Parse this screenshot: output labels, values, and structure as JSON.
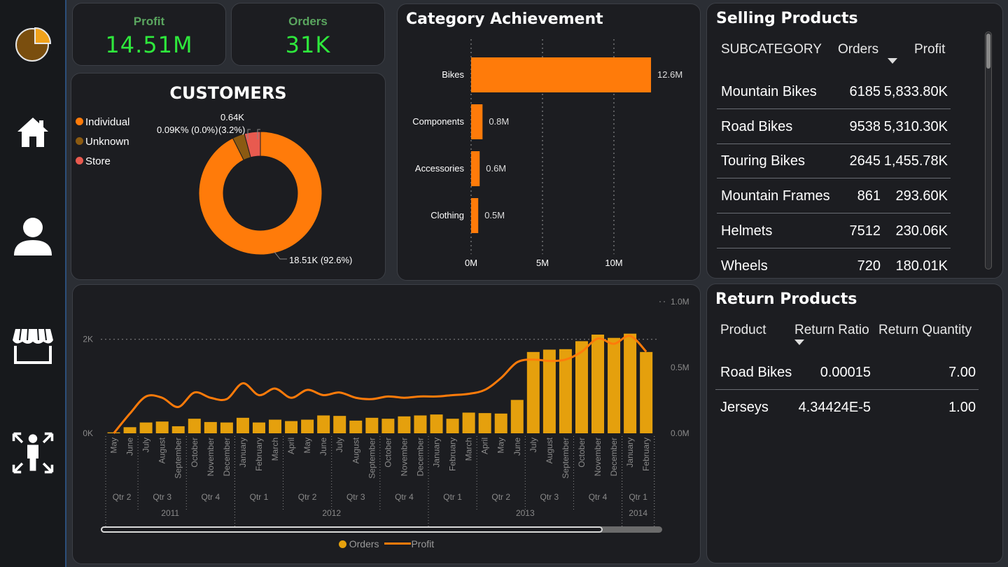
{
  "sidebar": {
    "items": [
      {
        "icon": "pie-logo-icon"
      },
      {
        "icon": "home-icon"
      },
      {
        "icon": "user-icon"
      },
      {
        "icon": "store-icon"
      },
      {
        "icon": "person-arrows-icon"
      }
    ]
  },
  "kpis": {
    "profit": {
      "label": "Profit",
      "value": "14.51M"
    },
    "orders": {
      "label": "Orders",
      "value": "31K"
    }
  },
  "customers": {
    "title": "CUSTOMERS",
    "legend": [
      {
        "label": "Individual",
        "color": "#ff7b0a"
      },
      {
        "label": "Unknown",
        "color": "#8b5a12"
      },
      {
        "label": "Store",
        "color": "#e85a4f"
      }
    ],
    "slices": [
      {
        "label": "Individual",
        "value": 18.51,
        "pct": 92.6,
        "color": "#ff7b0a"
      },
      {
        "label": "Unknown",
        "value": 0.64,
        "pct": 3.2,
        "color": "#8b5a12"
      },
      {
        "label": "Store",
        "value": 0.84,
        "pct": 4.2,
        "color": "#e85a4f"
      }
    ],
    "label_individual": "18.51K (92.6%)",
    "label_unknown_top": "0.64K",
    "label_unknown_bottom": "(3.2%)",
    "label_store": "0.09K% (0.0%)"
  },
  "category": {
    "title": "Category Achievement",
    "bar_color": "#ff7b0a",
    "xticks": [
      "0M",
      "5M",
      "10M"
    ]
  },
  "selling": {
    "title": "Selling Products",
    "headers": {
      "subcategory": "SUBCATEGORY",
      "orders": "Orders",
      "profit": "Profit"
    },
    "rows": [
      {
        "name": "Mountain Bikes",
        "orders": "6185",
        "profit": "5,833.80K"
      },
      {
        "name": "Road Bikes",
        "orders": "9538",
        "profit": "5,310.30K"
      },
      {
        "name": "Touring Bikes",
        "orders": "2645",
        "profit": "1,455.78K"
      },
      {
        "name": "Mountain Frames",
        "orders": "861",
        "profit": "293.60K"
      },
      {
        "name": "Helmets",
        "orders": "7512",
        "profit": "230.06K"
      },
      {
        "name": "Wheels",
        "orders": "720",
        "profit": "180.01K"
      }
    ]
  },
  "returns": {
    "title": "Return Products",
    "headers": {
      "product": "Product",
      "ratio": "Return Ratio",
      "qty": "Return Quantity"
    },
    "rows": [
      {
        "product": "Road Bikes",
        "ratio": "0.00015",
        "qty": "7.00"
      },
      {
        "product": "Jerseys",
        "ratio": "4.34424E-5",
        "qty": "1.00"
      }
    ]
  },
  "trend": {
    "left_ticks": [
      "2K",
      "0K"
    ],
    "right_ticks": [
      "1.0M",
      "0.5M",
      "0.0M"
    ],
    "months": [
      "May",
      "June",
      "July",
      "August",
      "September",
      "October",
      "November",
      "December",
      "January",
      "February",
      "March",
      "April",
      "May",
      "June",
      "July",
      "August",
      "September",
      "October",
      "November",
      "December",
      "January",
      "February",
      "March",
      "April",
      "May",
      "June",
      "July",
      "August",
      "September",
      "October",
      "November",
      "December",
      "January",
      "February"
    ],
    "quarters": [
      {
        "label": "Qtr 2",
        "span": 2
      },
      {
        "label": "Qtr 3",
        "span": 3
      },
      {
        "label": "Qtr 4",
        "span": 3
      },
      {
        "label": "Qtr 1",
        "span": 3
      },
      {
        "label": "Qtr 2",
        "span": 3
      },
      {
        "label": "Qtr 3",
        "span": 3
      },
      {
        "label": "Qtr 4",
        "span": 3
      },
      {
        "label": "Qtr 1",
        "span": 3
      },
      {
        "label": "Qtr 2",
        "span": 3
      },
      {
        "label": "Qtr 3",
        "span": 3
      },
      {
        "label": "Qtr 4",
        "span": 3
      },
      {
        "label": "Qtr 1",
        "span": 2
      }
    ],
    "years": [
      {
        "label": "2011",
        "span": 8
      },
      {
        "label": "2012",
        "span": 12
      },
      {
        "label": "2013",
        "span": 12
      },
      {
        "label": "2014",
        "span": 2
      }
    ],
    "legend_orders": "Orders",
    "legend_profit": "Profit",
    "bar_color": "#e5a00d",
    "line_color": "#ff7b0a"
  },
  "chart_data": [
    {
      "type": "bar",
      "title": "Category Achievement",
      "categories": [
        "Bikes",
        "Components",
        "Accessories",
        "Clothing"
      ],
      "values": [
        12.6,
        0.8,
        0.6,
        0.5
      ],
      "value_labels": [
        "12.6M",
        "0.8M",
        "0.6M",
        "0.5M"
      ],
      "orientation": "horizontal",
      "xlim": [
        0,
        13
      ],
      "grid": true
    },
    {
      "type": "bar",
      "x": [
        "May 2011",
        "Jun 2011",
        "Jul 2011",
        "Aug 2011",
        "Sep 2011",
        "Oct 2011",
        "Nov 2011",
        "Dec 2011",
        "Jan 2012",
        "Feb 2012",
        "Mar 2012",
        "Apr 2012",
        "May 2012",
        "Jun 2012",
        "Jul 2012",
        "Aug 2012",
        "Sep 2012",
        "Oct 2012",
        "Nov 2012",
        "Dec 2012",
        "Jan 2013",
        "Feb 2013",
        "Mar 2013",
        "Apr 2013",
        "May 2013",
        "Jun 2013",
        "Jul 2013",
        "Aug 2013",
        "Sep 2013",
        "Oct 2013",
        "Nov 2013",
        "Dec 2013",
        "Jan 2014",
        "Feb 2014"
      ],
      "ylim_left": [
        0,
        2800
      ],
      "ylim_right": [
        0,
        1.0
      ],
      "series": [
        {
          "name": "Orders",
          "values": [
            20,
            130,
            230,
            250,
            150,
            310,
            240,
            230,
            330,
            230,
            290,
            260,
            290,
            380,
            370,
            270,
            330,
            310,
            360,
            380,
            400,
            310,
            440,
            430,
            420,
            710,
            1730,
            1780,
            1790,
            1960,
            2100,
            2030,
            2120,
            1730
          ]
        },
        {
          "name": "Profit",
          "values": [
            0.0,
            0.15,
            0.28,
            0.27,
            0.2,
            0.31,
            0.27,
            0.26,
            0.38,
            0.29,
            0.34,
            0.27,
            0.33,
            0.29,
            0.31,
            0.27,
            0.26,
            0.28,
            0.27,
            0.28,
            0.28,
            0.29,
            0.3,
            0.33,
            0.42,
            0.54,
            0.56,
            0.55,
            0.56,
            0.62,
            0.72,
            0.68,
            0.74,
            0.62
          ]
        }
      ]
    }
  ]
}
